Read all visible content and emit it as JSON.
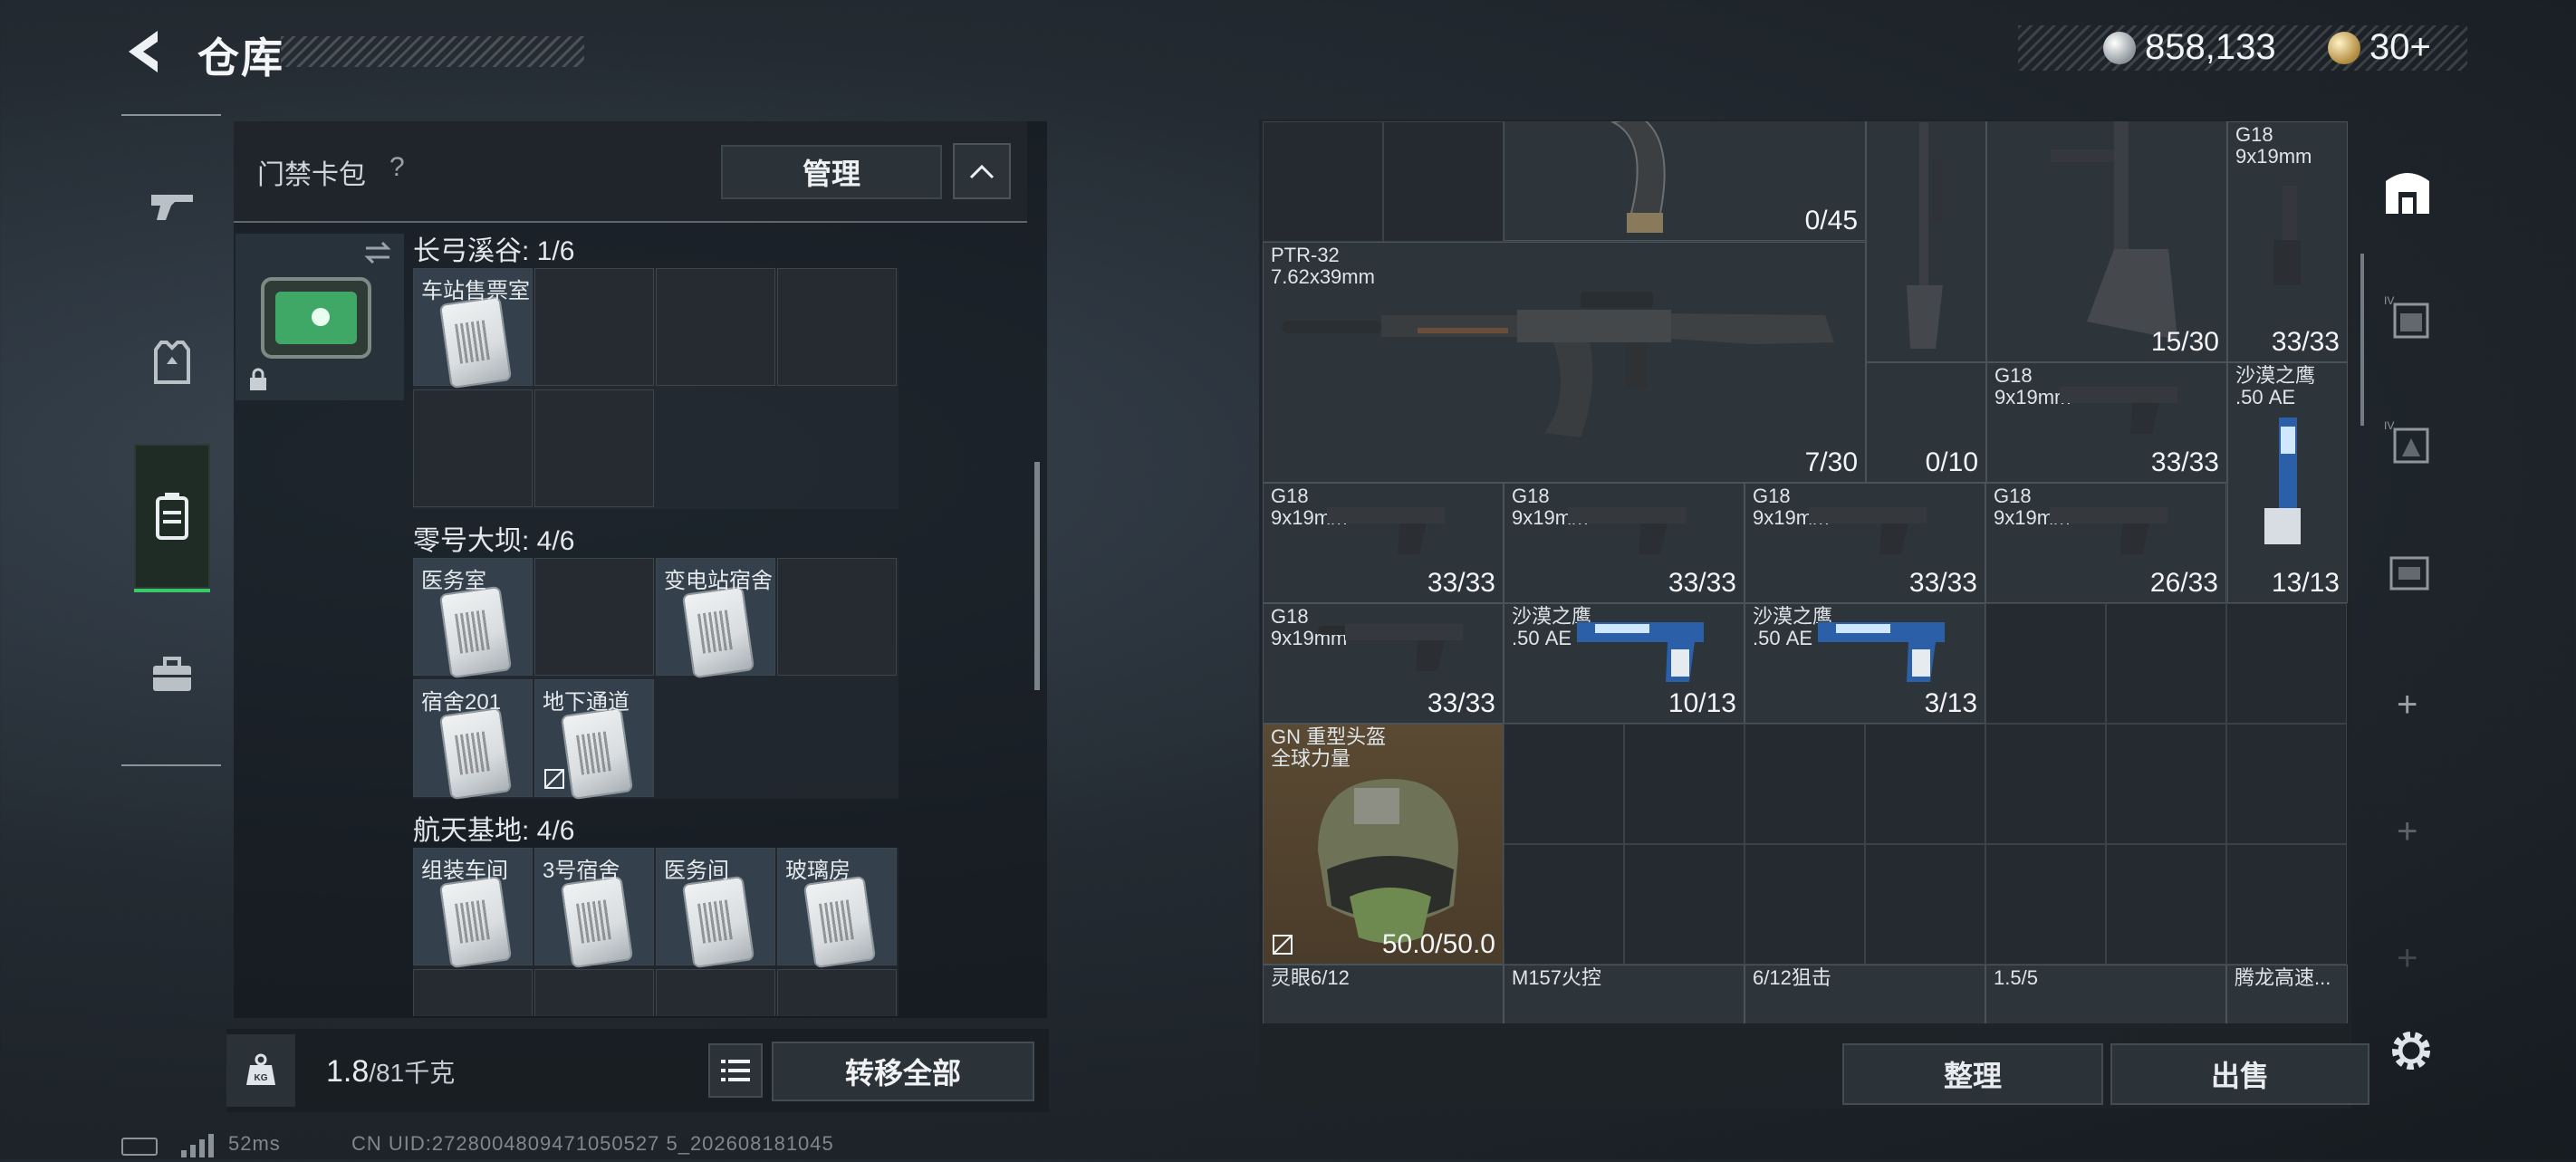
{
  "header": {
    "title": "仓库",
    "currency_silver": "858,133",
    "currency_gold": "30+"
  },
  "keycard_panel": {
    "title": "门禁卡包",
    "help": "?",
    "manage_label": "管理",
    "groups": [
      {
        "label": "长弓溪谷: 1/6",
        "cells": [
          "车站售票室"
        ]
      },
      {
        "label": "零号大坝: 4/6",
        "cells": [
          "医务室",
          "",
          "变电站宿舍",
          "宿舍201",
          "地下通道"
        ]
      },
      {
        "label": "航天基地: 4/6",
        "cells": [
          "组装车间",
          "3号宿舍",
          "医务间",
          "玻璃房"
        ]
      }
    ]
  },
  "bottom_left": {
    "weight_value": "1.8",
    "weight_cap": "/81千克",
    "kg_badge": "KG",
    "transfer_label": "转移全部"
  },
  "stash": {
    "items": [
      {
        "name": "",
        "count": "0/45"
      },
      {
        "name": "G18\n9x19mm",
        "count": ""
      },
      {
        "name": "PTR-32\n7.62x39mm",
        "count": "7/30"
      },
      {
        "name": "",
        "count": "0/10"
      },
      {
        "name": "",
        "count": "15/30"
      },
      {
        "name": "",
        "count": "33/33"
      },
      {
        "name": "G18\n9x19mm",
        "count": "33/33"
      },
      {
        "name": "沙漠之鹰\n.50 AE",
        "count": ""
      },
      {
        "name": "G18\n9x19mm",
        "count": "33/33"
      },
      {
        "name": "G18\n9x19mm",
        "count": "33/33"
      },
      {
        "name": "G18\n9x19mm",
        "count": "33/33"
      },
      {
        "name": "G18\n9x19mm",
        "count": "26/33"
      },
      {
        "name": "",
        "count": "13/13"
      },
      {
        "name": "G18\n9x19mm",
        "count": "33/33"
      },
      {
        "name": "沙漠之鹰\n.50 AE",
        "count": "10/13"
      },
      {
        "name": "沙漠之鹰\n.50 AE",
        "count": "3/13"
      },
      {
        "name": "GN 重型头盔\n全球力量",
        "count": "50.0/50.0"
      },
      {
        "name": "灵眼6/12",
        "count": ""
      },
      {
        "name": "M157火控",
        "count": ""
      },
      {
        "name": "6/12狙击",
        "count": ""
      },
      {
        "name": "1.5/5",
        "count": ""
      },
      {
        "name": "腾龙高速...",
        "count": ""
      }
    ],
    "sort_label": "整理",
    "sell_label": "出售"
  },
  "footer": {
    "ping": "52ms",
    "uid": "CN UID:2728004809471050527 5_202608181045"
  },
  "colors": {
    "accent_green": "#39c86a",
    "panel_bg": "#242a30"
  }
}
